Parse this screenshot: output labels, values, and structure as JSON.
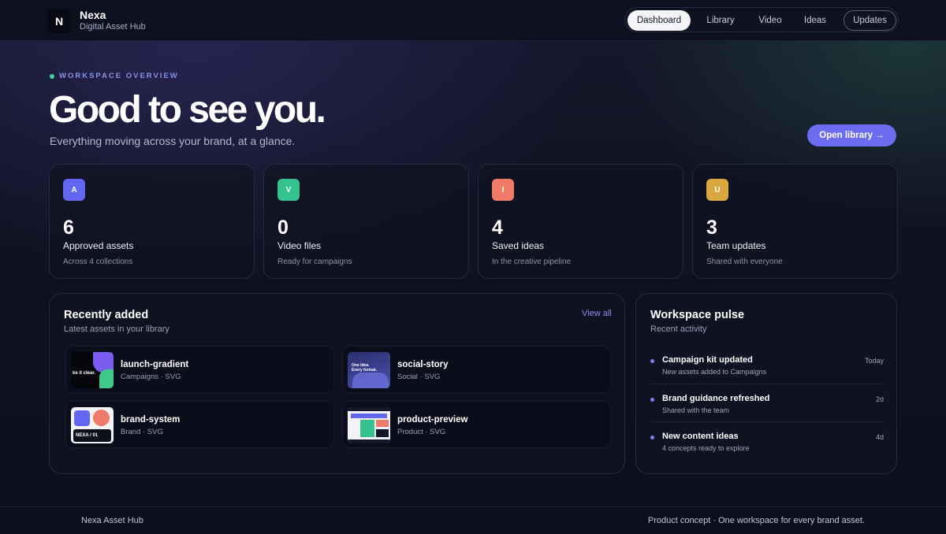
{
  "header": {
    "logo_letter": "N",
    "brand_name": "Nexa",
    "brand_sub": "Digital Asset Hub",
    "nav": [
      {
        "label": "Dashboard",
        "state": "active"
      },
      {
        "label": "Library",
        "state": "default"
      },
      {
        "label": "Video",
        "state": "default"
      },
      {
        "label": "Ideas",
        "state": "default"
      },
      {
        "label": "Updates",
        "state": "outlined"
      }
    ]
  },
  "hero": {
    "eyebrow": "WORKSPACE OVERVIEW",
    "title": "Good to see you.",
    "subtitle": "Everything moving across your brand, at a glance.",
    "cta_label": "Open library →"
  },
  "stats": [
    {
      "badge": "A",
      "value": "6",
      "label": "Approved assets",
      "note": "Across 4 collections",
      "color": "#6366f1"
    },
    {
      "badge": "V",
      "value": "0",
      "label": "Video files",
      "note": "Ready for campaigns",
      "color": "#34c38f"
    },
    {
      "badge": "I",
      "value": "4",
      "label": "Saved ideas",
      "note": "In the creative pipeline",
      "color": "#f07a68"
    },
    {
      "badge": "U",
      "value": "3",
      "label": "Team updates",
      "note": "Shared with everyone",
      "color": "#d9a640"
    }
  ],
  "recent": {
    "title": "Recently added",
    "subtitle": "Latest assets in your library",
    "view_all": "View all",
    "items": [
      {
        "name": "launch-gradient",
        "meta": "Campaigns · SVG",
        "thumb_text": "ke it clear."
      },
      {
        "name": "social-story",
        "meta": "Social · SVG",
        "thumb_text": "One idea. Every format."
      },
      {
        "name": "brand-system",
        "meta": "Brand · SVG",
        "thumb_text": "NEXA / 01"
      },
      {
        "name": "product-preview",
        "meta": "Product · SVG",
        "thumb_text": ""
      }
    ]
  },
  "pulse": {
    "title": "Workspace pulse",
    "subtitle": "Recent activity",
    "items": [
      {
        "title": "Campaign kit updated",
        "desc": "New assets added to Campaigns",
        "time": "Today"
      },
      {
        "title": "Brand guidance refreshed",
        "desc": "Shared with the team",
        "time": "2d"
      },
      {
        "title": "New content ideas",
        "desc": "4 concepts ready to explore",
        "time": "4d"
      }
    ]
  },
  "footer": {
    "left": "Nexa Asset Hub",
    "right": "Product concept · One workspace for every brand asset."
  },
  "colors": {
    "accent": "#6c6cf0",
    "eyebrow_dot": "#3fd39a",
    "background": "#0f1120"
  }
}
